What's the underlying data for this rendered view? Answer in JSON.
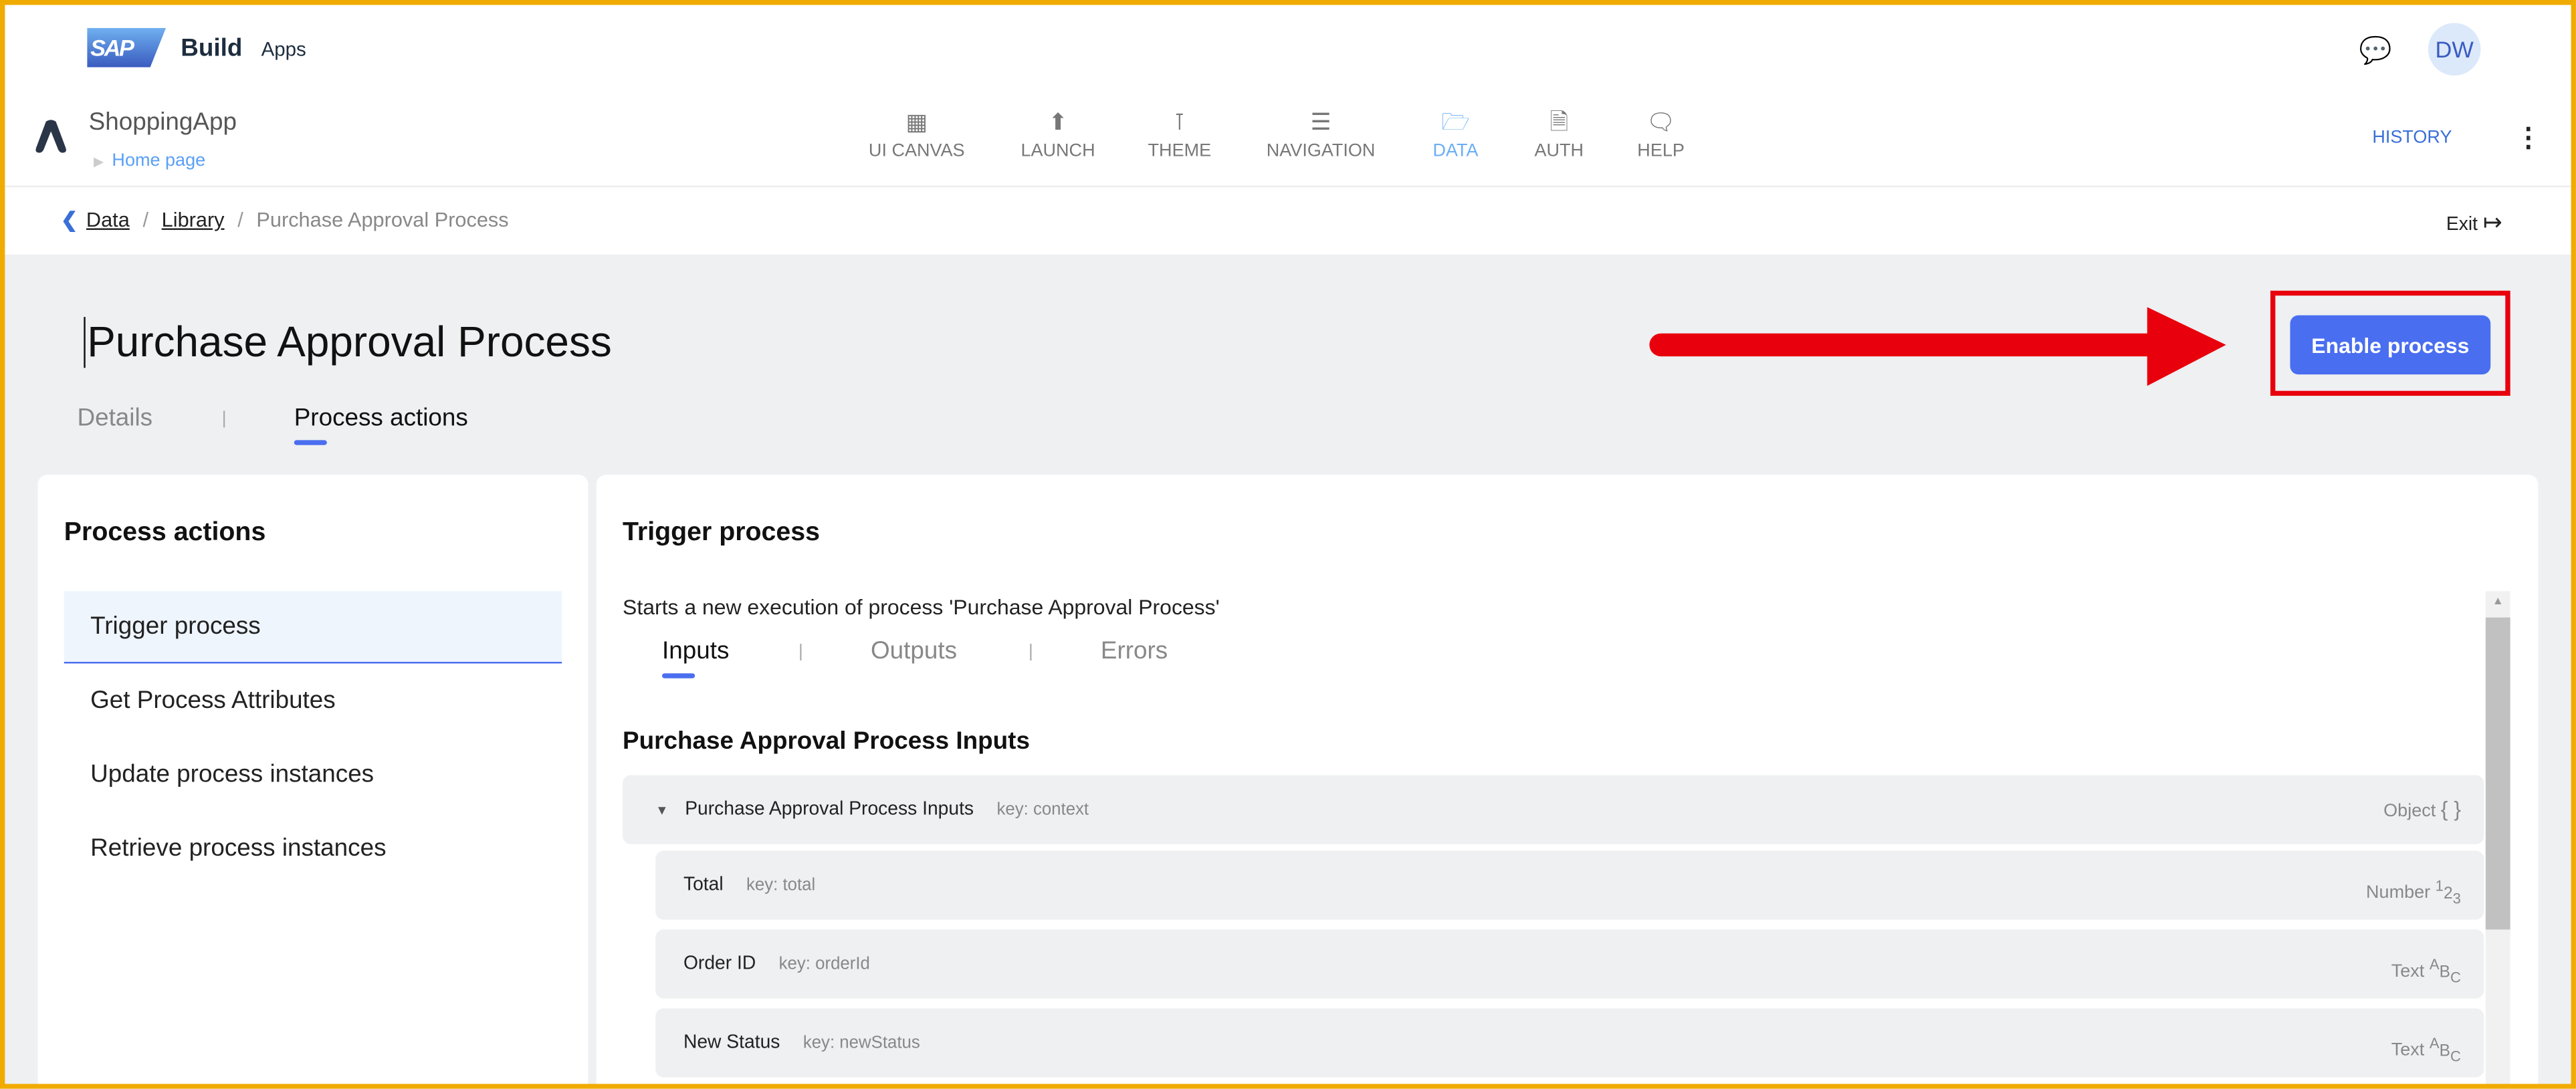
{
  "header": {
    "brand": "SAP",
    "product": "Build",
    "product_sub": "Apps",
    "avatar": "DW"
  },
  "app": {
    "name": "ShoppingApp",
    "page": "Home page"
  },
  "nav": [
    {
      "label": "UI CANVAS",
      "icon": "canvas-icon"
    },
    {
      "label": "LAUNCH",
      "icon": "launch-icon"
    },
    {
      "label": "THEME",
      "icon": "theme-icon"
    },
    {
      "label": "NAVIGATION",
      "icon": "navigation-icon"
    },
    {
      "label": "DATA",
      "icon": "folder-icon",
      "active": true
    },
    {
      "label": "AUTH",
      "icon": "auth-icon"
    },
    {
      "label": "HELP",
      "icon": "help-icon"
    }
  ],
  "history": "HISTORY",
  "breadcrumb": {
    "items": [
      "Data",
      "Library"
    ],
    "current": "Purchase Approval Process"
  },
  "exit": "Exit",
  "page": {
    "title": "Purchase Approval Process",
    "enable_button": "Enable process",
    "tabs": [
      "Details",
      "Process actions"
    ],
    "separator": "|"
  },
  "left": {
    "title": "Process actions",
    "items": [
      "Trigger process",
      "Get Process Attributes",
      "Update process instances",
      "Retrieve process instances"
    ]
  },
  "right": {
    "title": "Trigger process",
    "description": "Starts a new execution of process 'Purchase Approval Process'",
    "subtabs": [
      "Inputs",
      "Outputs",
      "Errors"
    ],
    "section": "Purchase Approval Process Inputs",
    "root": {
      "name": "Purchase Approval Process Inputs",
      "key": "key: context",
      "type": "Object",
      "type_icon": "{ }"
    },
    "fields": [
      {
        "name": "Total",
        "key": "key: total",
        "type": "Number",
        "i1": "1",
        "i2": "2",
        "i3": "3"
      },
      {
        "name": "Order ID",
        "key": "key: orderId",
        "type": "Text",
        "i1": "A",
        "i2": "B",
        "i3": "C"
      },
      {
        "name": "New Status",
        "key": "key: newStatus",
        "type": "Text",
        "i1": "A",
        "i2": "B",
        "i3": "C"
      }
    ]
  },
  "colors": {
    "accent": "#4a6ef0",
    "annotation": "#e8000c",
    "frame": "#f0ab00"
  }
}
